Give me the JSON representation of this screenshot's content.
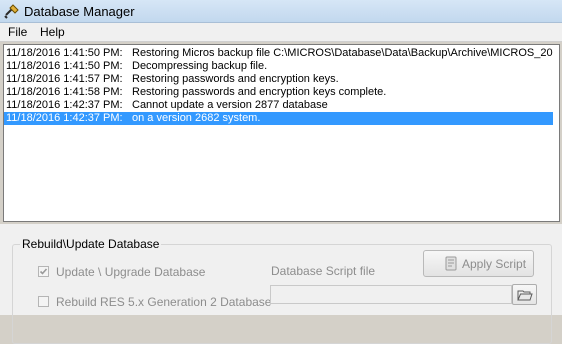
{
  "window": {
    "title": "Database Manager"
  },
  "menu": {
    "items": [
      "File",
      "Help"
    ]
  },
  "log": {
    "entries": [
      {
        "timestamp": "11/18/2016 1:41:50 PM:",
        "message": "Restoring Micros backup file C:\\MICROS\\Database\\Data\\Backup\\Archive\\MICROS_20"
      },
      {
        "timestamp": "11/18/2016 1:41:50 PM:",
        "message": "Decompressing backup file."
      },
      {
        "timestamp": "11/18/2016 1:41:57 PM:",
        "message": "Restoring passwords and encryption keys."
      },
      {
        "timestamp": "11/18/2016 1:41:58 PM:",
        "message": "Restoring passwords and encryption keys complete."
      },
      {
        "timestamp": "11/18/2016 1:42:37 PM:",
        "message": "Cannot update a version 2877 database"
      },
      {
        "timestamp": "11/18/2016 1:42:37 PM:",
        "message": "on a version  2682 system."
      }
    ],
    "selected_index": 5,
    "selection_color": "#3399ff"
  },
  "rebuild": {
    "group_title": "Rebuild\\Update Database",
    "update_label": "Update \\ Upgrade Database",
    "update_checked": true,
    "rebuild_label": "Rebuild RES 5.x Generation 2 Database",
    "rebuild_checked": false,
    "script_label": "Database Script file",
    "script_value": "",
    "apply_label": "Apply Script"
  },
  "icons": {
    "app": "database-manager-icon",
    "apply": "script-icon",
    "browse": "folder-open-icon"
  }
}
